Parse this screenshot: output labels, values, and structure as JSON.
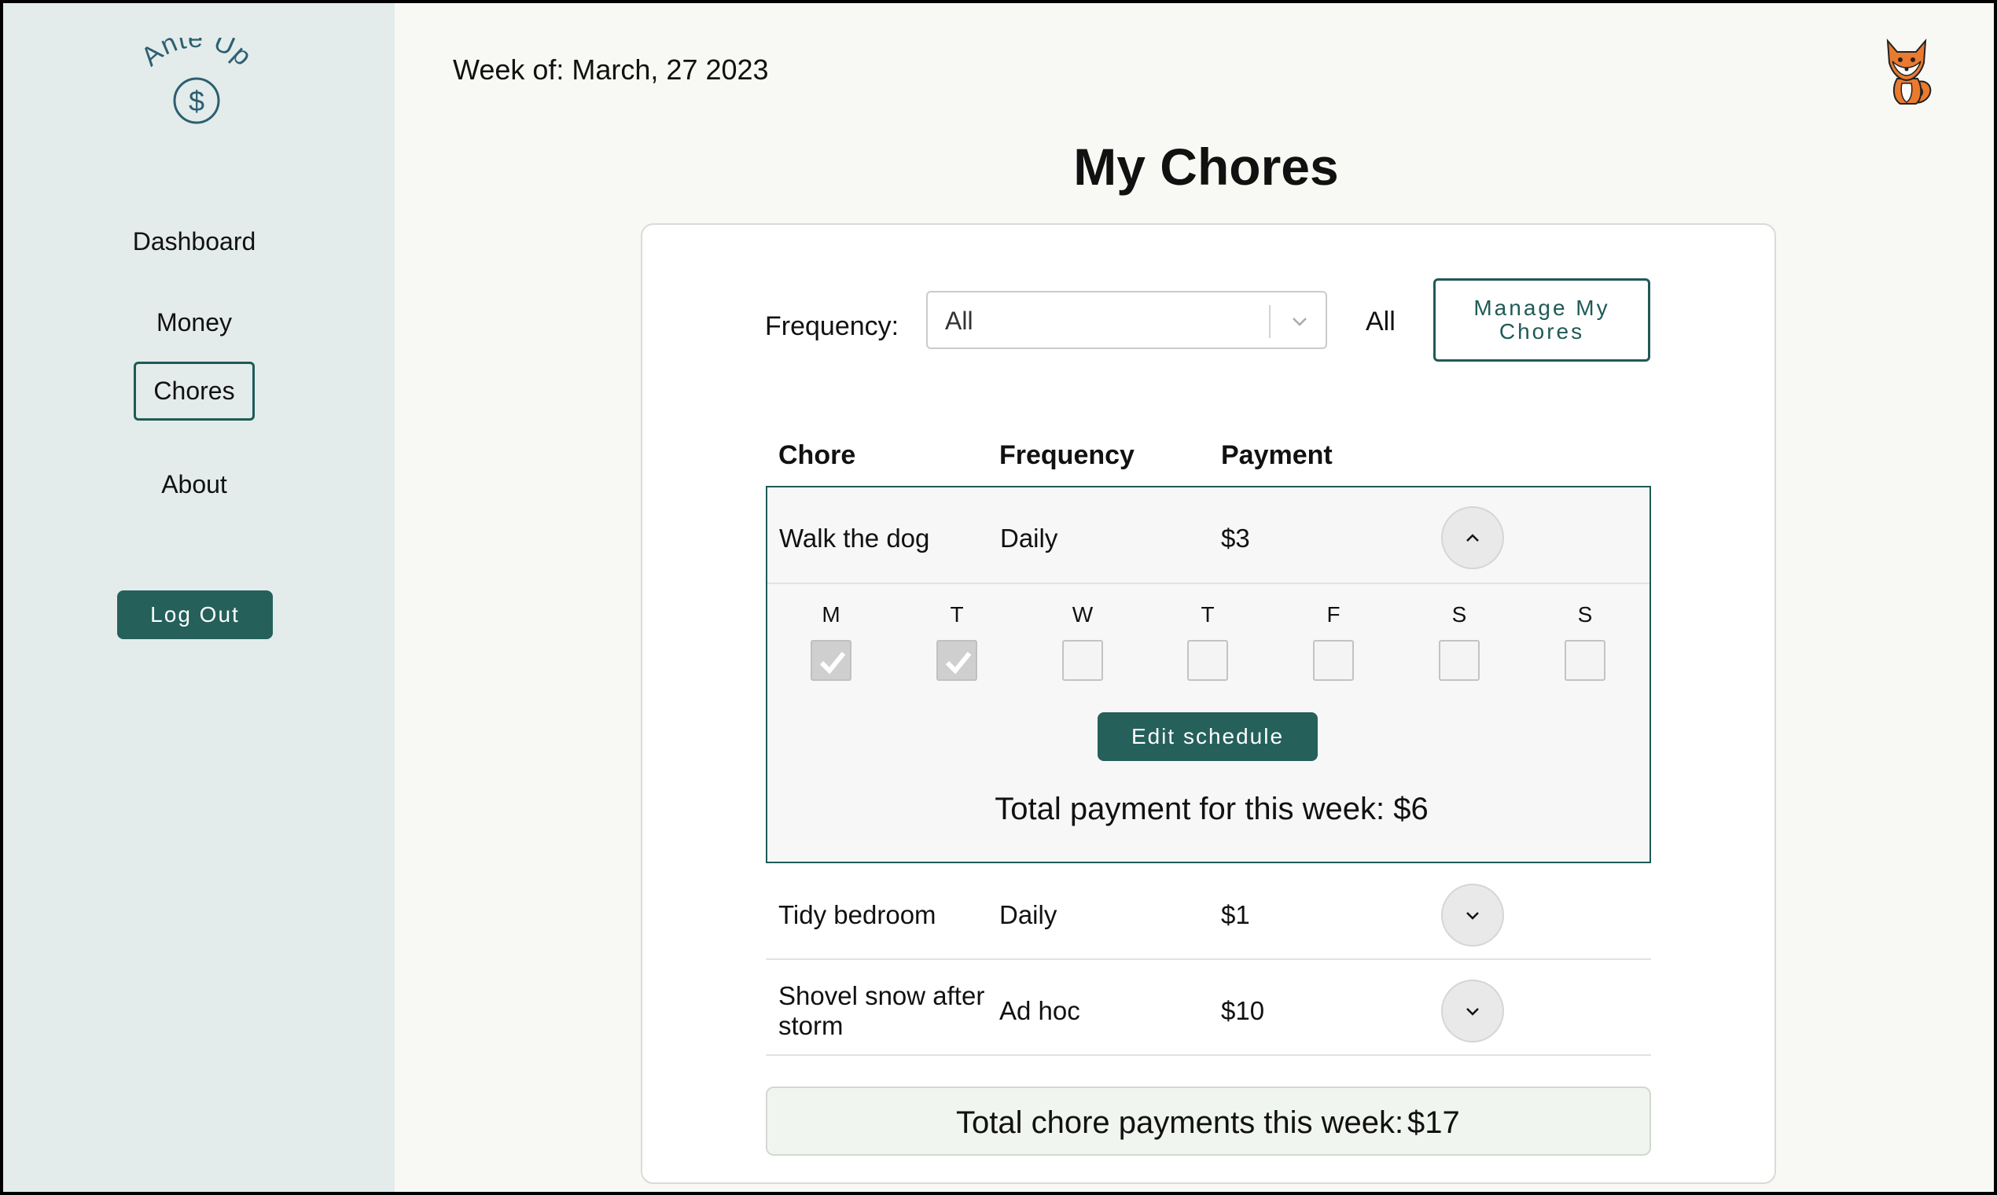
{
  "app": {
    "logo_text": "Ante Up",
    "logo_symbol": "$"
  },
  "sidebar": {
    "items": [
      {
        "label": "Dashboard",
        "active": false
      },
      {
        "label": "Money",
        "active": false
      },
      {
        "label": "Chores",
        "active": true
      },
      {
        "label": "About",
        "active": false
      }
    ],
    "logout_label": "Log Out"
  },
  "header": {
    "week": "Week of: March, 27 2023",
    "avatar_icon": "fox-icon"
  },
  "page": {
    "title": "My Chores"
  },
  "filter": {
    "label": "Frequency:",
    "selected": "All",
    "status_text": "All",
    "manage_label_line1": "Manage My",
    "manage_label_line2": "Chores"
  },
  "table": {
    "headers": {
      "chore": "Chore",
      "frequency": "Frequency",
      "payment": "Payment"
    },
    "rows": [
      {
        "chore": "Walk the dog",
        "frequency": "Daily",
        "payment": "$3",
        "expanded": true,
        "days": [
          {
            "label": "M",
            "checked": true
          },
          {
            "label": "T",
            "checked": true
          },
          {
            "label": "W",
            "checked": false
          },
          {
            "label": "T",
            "checked": false
          },
          {
            "label": "F",
            "checked": false
          },
          {
            "label": "S",
            "checked": false
          },
          {
            "label": "S",
            "checked": false
          }
        ],
        "edit_label": "Edit schedule",
        "week_total": "Total payment for this week: $6"
      },
      {
        "chore": "Tidy bedroom",
        "frequency": "Daily",
        "payment": "$1",
        "expanded": false
      },
      {
        "chore_line1": "Shovel snow after",
        "chore_line2": "storm",
        "frequency": "Ad hoc",
        "payment": "$10",
        "expanded": false
      }
    ]
  },
  "totals": {
    "label": "Total chore payments this week:",
    "value": "$17"
  },
  "colors": {
    "accent": "#25605b",
    "sidebar_bg": "#e3ecea",
    "page_bg": "#f8f9f4"
  }
}
